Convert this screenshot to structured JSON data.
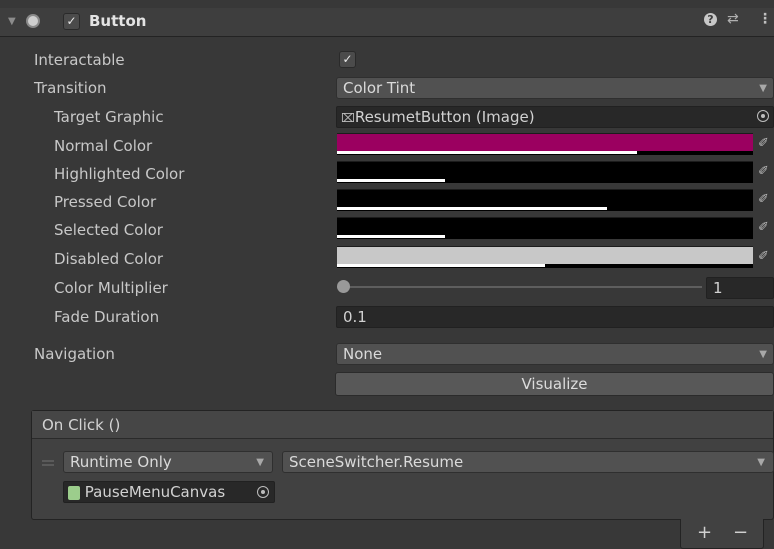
{
  "component": {
    "title": "Button",
    "icons": [
      "collapse-arrow-icon",
      "button-component-icon",
      "enabled-checkbox-icon",
      "help-icon",
      "presets-icon",
      "kebab-menu-icon"
    ]
  },
  "fields": {
    "interactable": {
      "label": "Interactable",
      "checked": true,
      "check_glyph": "✓"
    },
    "transition": {
      "label": "Transition",
      "value": "Color Tint"
    },
    "target_graphic": {
      "label": "Target Graphic",
      "value": "ResumetButton (Image)"
    },
    "normal_color": {
      "label": "Normal Color",
      "color": "#9b0060",
      "alpha": 0.72
    },
    "highlighted_color": {
      "label": "Highlighted Color",
      "color": "#000000",
      "alpha": 0.26
    },
    "pressed_color": {
      "label": "Pressed Color",
      "color": "#000000",
      "alpha": 0.65
    },
    "selected_color": {
      "label": "Selected Color",
      "color": "#000000",
      "alpha": 0.26
    },
    "disabled_color": {
      "label": "Disabled Color",
      "color": "#c8c8c8",
      "alpha": 0.5
    },
    "color_multiplier": {
      "label": "Color Multiplier",
      "value": "1",
      "slider_fraction": 0.0
    },
    "fade_duration": {
      "label": "Fade Duration",
      "value": "0.1"
    },
    "navigation": {
      "label": "Navigation",
      "value": "None"
    },
    "visualize_button": "Visualize"
  },
  "on_click": {
    "header": "On Click ()",
    "call_state": "Runtime Only",
    "function": "SceneSwitcher.Resume",
    "target_object": "PauseMenuCanvas",
    "add_label": "+",
    "remove_label": "−"
  },
  "colors": {
    "background": "#383838",
    "normal_swatch": "#9b0060",
    "disabled_swatch": "#c8c8c8"
  }
}
